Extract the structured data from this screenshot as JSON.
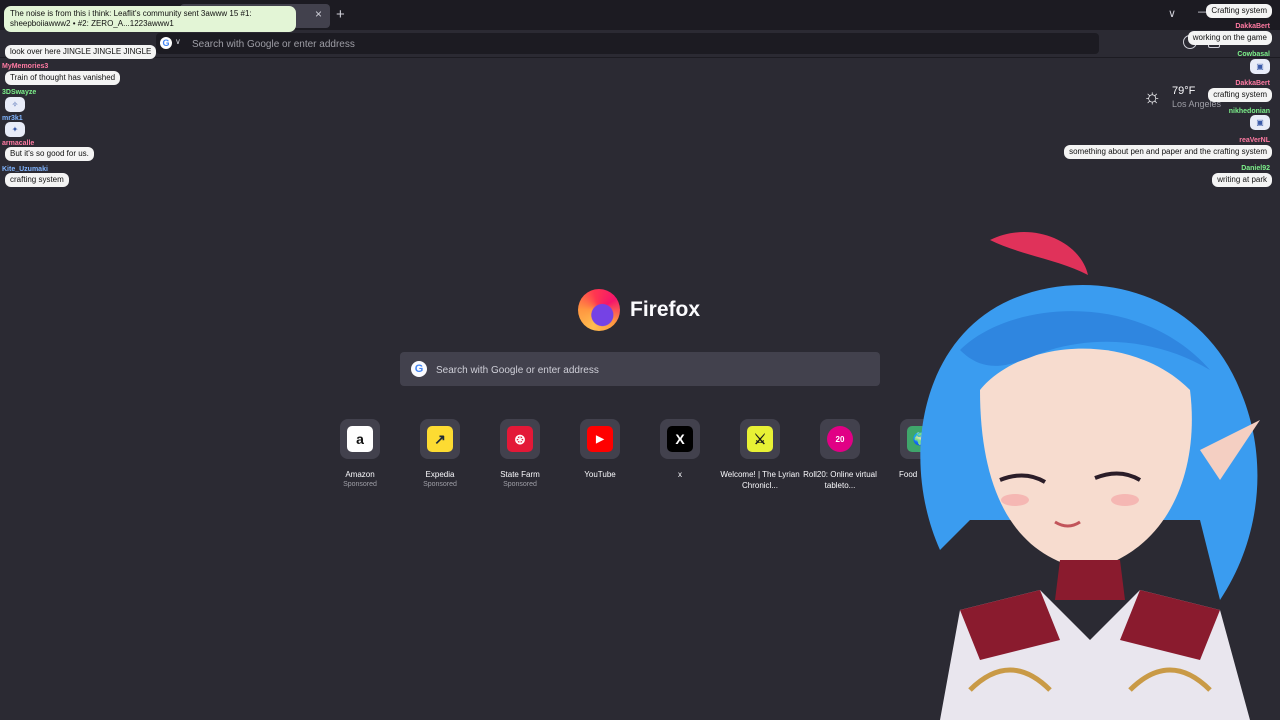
{
  "browser": {
    "tab_title": "",
    "new_tab_icon": "plus-icon",
    "urlbar_placeholder": "Search with Google or enter address",
    "engine_letter": "G"
  },
  "weather": {
    "temperature": "79°F",
    "location": "Los Angeles",
    "icon": "sun-icon"
  },
  "brand": {
    "name": "Firefox"
  },
  "search": {
    "placeholder": "Search with Google or enter address",
    "engine_letter": "G"
  },
  "top_sites": [
    {
      "title": "Amazon",
      "sponsor": "Sponsored",
      "icon": "amazon-icon",
      "glyph": "a",
      "bg": "#ffffff",
      "fg": "#111111"
    },
    {
      "title": "Expedia",
      "sponsor": "Sponsored",
      "icon": "expedia-icon",
      "glyph": "↗",
      "bg": "#fddb32",
      "fg": "#1f2937"
    },
    {
      "title": "State Farm",
      "sponsor": "Sponsored",
      "icon": "statefarm-icon",
      "glyph": "⊛",
      "bg": "#e31837",
      "fg": "#ffffff"
    },
    {
      "title": "YouTube",
      "sponsor": "",
      "icon": "youtube-icon",
      "glyph": "▶",
      "bg": "#ff0000",
      "fg": "#ffffff"
    },
    {
      "title": "x",
      "sponsor": "",
      "icon": "x-icon",
      "glyph": "X",
      "bg": "#000000",
      "fg": "#ffffff"
    },
    {
      "title": "Welcome! | The Lyrian Chronicl...",
      "sponsor": "",
      "icon": "lyrian-icon",
      "glyph": "⚔",
      "bg": "#e8f135",
      "fg": "#1b1b1b"
    },
    {
      "title": "Roll20: Online virtual tableto...",
      "sponsor": "",
      "icon": "roll20-icon",
      "glyph": "20",
      "bg": "#e10085",
      "fg": "#ffffff"
    },
    {
      "title": "Food",
      "sponsor": "",
      "icon": "globe-icon",
      "glyph": "🌍",
      "bg": "#3fa66b",
      "fg": "#ffffff"
    }
  ],
  "chat_left": {
    "notice": "The noise is from this i think: Leaflit's community sent 3awww 15 #1: sheepboiiawww2 • #2: ZERO_A...1223awww1",
    "messages": [
      {
        "user": "look over here JINGLE JINGLE JINGLE",
        "text": "look over here JINGLE JINGLE JINGLE"
      },
      {
        "user": "MyMemories3",
        "text": "Train of thought has vanished"
      },
      {
        "user": "3DSwayze",
        "text": ""
      },
      {
        "user": "mr3k1",
        "text": ""
      },
      {
        "user": "armacalle",
        "text": "But it's so good for us."
      },
      {
        "user": "Kite_Uzumaki",
        "text": "crafting system"
      }
    ]
  },
  "chat_right": {
    "messages": [
      {
        "user": "",
        "text": "Crafting system"
      },
      {
        "user": "DakkaBert",
        "text": "working on the game"
      },
      {
        "user": "Cowbasal",
        "text": ""
      },
      {
        "user": "DakkaBert",
        "text": "crafting system"
      },
      {
        "user": "nikhedonian",
        "text": ""
      },
      {
        "user": "reaVerNL",
        "text": "something about pen and paper and the crafting system"
      },
      {
        "user": "Daniel92",
        "text": "writing at park"
      }
    ]
  },
  "colors": {
    "page_bg": "#2b2a33",
    "tile_bg": "#42414d",
    "chrome_bg": "#1c1b22"
  }
}
